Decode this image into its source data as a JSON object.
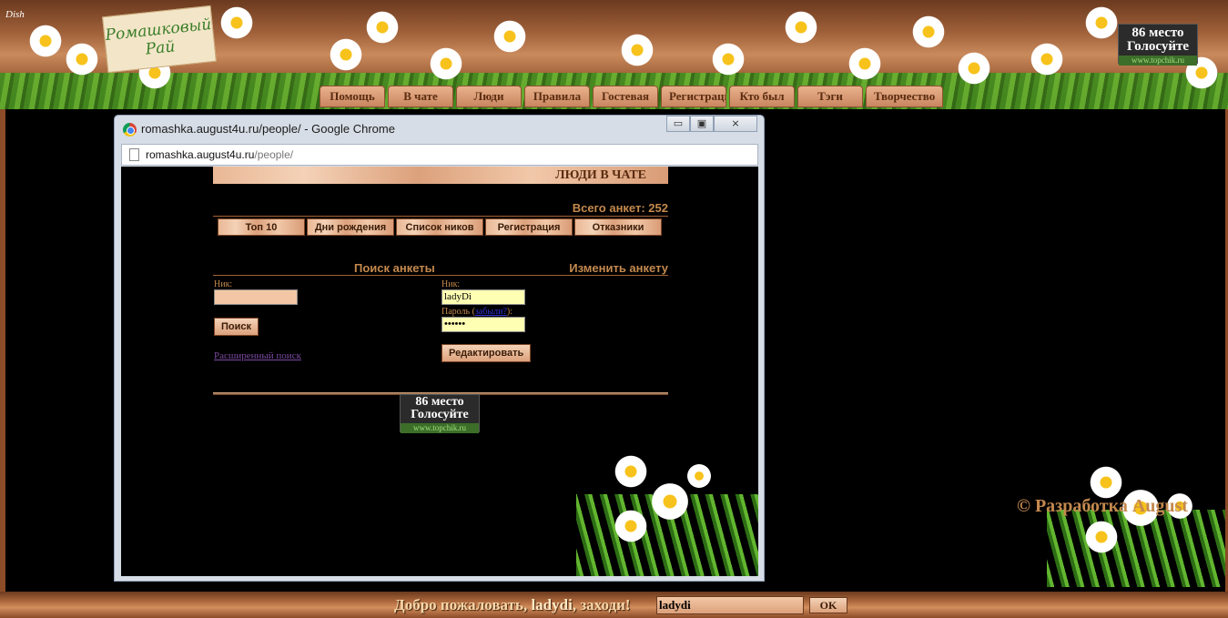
{
  "site": {
    "logo_text": "Ромашковый Рай",
    "corner_text": "Dish",
    "topchik": {
      "place": "86 место",
      "vote": "Голосуйте",
      "url": "www.topchik.ru"
    }
  },
  "nav": {
    "items": [
      {
        "label": "Помощь"
      },
      {
        "label": "В чате"
      },
      {
        "label": "Люди"
      },
      {
        "label": "Правила"
      },
      {
        "label": "Гостевая"
      },
      {
        "label": "Регистрация"
      },
      {
        "label": "Кто был"
      },
      {
        "label": "Тэги"
      },
      {
        "label": "Творчество"
      }
    ]
  },
  "browser": {
    "title": "romashka.august4u.ru/people/ - Google Chrome",
    "url_host": "romashka.august4u.ru",
    "url_path": "/people/",
    "buttons": {
      "minimize": "▭",
      "maximize": "▣",
      "close": "⨯"
    }
  },
  "people": {
    "header": "ЛЮДИ В ЧАТЕ",
    "total": "Всего анкет: 252",
    "tabs": [
      {
        "label": "Топ 10"
      },
      {
        "label": "Дни рождения"
      },
      {
        "label": "Список ников"
      },
      {
        "label": "Регистрация"
      },
      {
        "label": "Отказники"
      }
    ],
    "search": {
      "heading": "Поиск анкеты",
      "nick_label": "Ник:",
      "nick_value": "",
      "button": "Поиск",
      "advanced_link": "Расширенный поиск"
    },
    "edit": {
      "heading": "Изменить анкету",
      "nick_label": "Ник:",
      "nick_value": "ladyDi",
      "password_label_prefix": "Пароль (",
      "password_link": "забыли?",
      "password_label_suffix": "):",
      "password_value": "••••••",
      "button": "Редактировать"
    }
  },
  "copyright": "© Разработка August",
  "footer": {
    "welcome_prefix": "Добро пожаловать, ",
    "welcome_name": "ladydi",
    "welcome_suffix": ", заходи!",
    "nick_value": "ladydi",
    "ok_button": "OK"
  },
  "colors": {
    "accent": "#c4894e",
    "wood_dark": "#6b3a1f",
    "background": "#000000"
  }
}
